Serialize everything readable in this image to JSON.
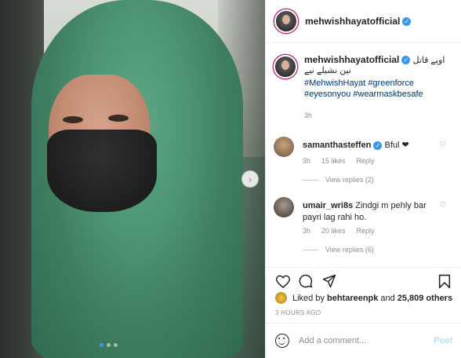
{
  "post": {
    "username": "mehwishhayatofficial",
    "verified_mark": "✓",
    "caption_urdu": "اوپے قاتل نین نشیلے نیے",
    "hashtags": [
      "#MehwishHayat #greenforce",
      "#eyesonyou #wearmaskbesafe"
    ],
    "caption_time": "3h"
  },
  "comments": [
    {
      "username": "samanthasteffen",
      "verified": true,
      "text": "Bful ❤",
      "time": "3h",
      "likes": "15 likes",
      "reply": "Reply",
      "view_replies": "View replies (2)"
    },
    {
      "username": "umair_wri8s",
      "verified": false,
      "text": "Zindgi m pehly bar payri lag rahi ho.",
      "time": "3h",
      "likes": "20 likes",
      "reply": "Reply",
      "view_replies": "View replies (6)"
    }
  ],
  "likes": {
    "prefix": "Liked by",
    "user": "behtareenpk",
    "mid": "and",
    "others": "25,809 others"
  },
  "timestamp": "3 HOURS AGO",
  "add_comment": {
    "placeholder": "Add a comment...",
    "post_label": "Post"
  },
  "carousel": {
    "slide_count": 3,
    "active_index": 0
  },
  "colors": {
    "verified_blue": "#3897f0",
    "link_blue": "#00376b",
    "muted": "#8e8e8e",
    "post_disabled": "#b2dffc"
  },
  "icons": [
    "heart-icon",
    "comment-icon",
    "share-icon",
    "bookmark-icon",
    "emoji-icon",
    "chevron-right-icon"
  ]
}
